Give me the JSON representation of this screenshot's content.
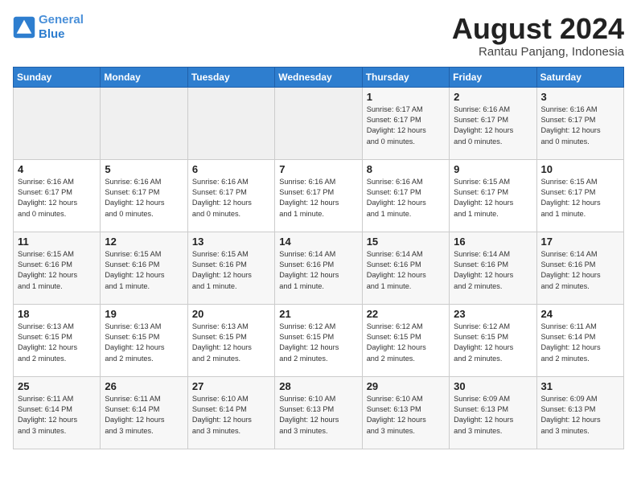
{
  "header": {
    "logo_line1": "General",
    "logo_line2": "Blue",
    "month_year": "August 2024",
    "location": "Rantau Panjang, Indonesia"
  },
  "days_of_week": [
    "Sunday",
    "Monday",
    "Tuesday",
    "Wednesday",
    "Thursday",
    "Friday",
    "Saturday"
  ],
  "weeks": [
    [
      {
        "day": "",
        "info": ""
      },
      {
        "day": "",
        "info": ""
      },
      {
        "day": "",
        "info": ""
      },
      {
        "day": "",
        "info": ""
      },
      {
        "day": "1",
        "info": "Sunrise: 6:17 AM\nSunset: 6:17 PM\nDaylight: 12 hours\nand 0 minutes."
      },
      {
        "day": "2",
        "info": "Sunrise: 6:16 AM\nSunset: 6:17 PM\nDaylight: 12 hours\nand 0 minutes."
      },
      {
        "day": "3",
        "info": "Sunrise: 6:16 AM\nSunset: 6:17 PM\nDaylight: 12 hours\nand 0 minutes."
      }
    ],
    [
      {
        "day": "4",
        "info": "Sunrise: 6:16 AM\nSunset: 6:17 PM\nDaylight: 12 hours\nand 0 minutes."
      },
      {
        "day": "5",
        "info": "Sunrise: 6:16 AM\nSunset: 6:17 PM\nDaylight: 12 hours\nand 0 minutes."
      },
      {
        "day": "6",
        "info": "Sunrise: 6:16 AM\nSunset: 6:17 PM\nDaylight: 12 hours\nand 0 minutes."
      },
      {
        "day": "7",
        "info": "Sunrise: 6:16 AM\nSunset: 6:17 PM\nDaylight: 12 hours\nand 1 minute."
      },
      {
        "day": "8",
        "info": "Sunrise: 6:16 AM\nSunset: 6:17 PM\nDaylight: 12 hours\nand 1 minute."
      },
      {
        "day": "9",
        "info": "Sunrise: 6:15 AM\nSunset: 6:17 PM\nDaylight: 12 hours\nand 1 minute."
      },
      {
        "day": "10",
        "info": "Sunrise: 6:15 AM\nSunset: 6:17 PM\nDaylight: 12 hours\nand 1 minute."
      }
    ],
    [
      {
        "day": "11",
        "info": "Sunrise: 6:15 AM\nSunset: 6:16 PM\nDaylight: 12 hours\nand 1 minute."
      },
      {
        "day": "12",
        "info": "Sunrise: 6:15 AM\nSunset: 6:16 PM\nDaylight: 12 hours\nand 1 minute."
      },
      {
        "day": "13",
        "info": "Sunrise: 6:15 AM\nSunset: 6:16 PM\nDaylight: 12 hours\nand 1 minute."
      },
      {
        "day": "14",
        "info": "Sunrise: 6:14 AM\nSunset: 6:16 PM\nDaylight: 12 hours\nand 1 minute."
      },
      {
        "day": "15",
        "info": "Sunrise: 6:14 AM\nSunset: 6:16 PM\nDaylight: 12 hours\nand 1 minute."
      },
      {
        "day": "16",
        "info": "Sunrise: 6:14 AM\nSunset: 6:16 PM\nDaylight: 12 hours\nand 2 minutes."
      },
      {
        "day": "17",
        "info": "Sunrise: 6:14 AM\nSunset: 6:16 PM\nDaylight: 12 hours\nand 2 minutes."
      }
    ],
    [
      {
        "day": "18",
        "info": "Sunrise: 6:13 AM\nSunset: 6:15 PM\nDaylight: 12 hours\nand 2 minutes."
      },
      {
        "day": "19",
        "info": "Sunrise: 6:13 AM\nSunset: 6:15 PM\nDaylight: 12 hours\nand 2 minutes."
      },
      {
        "day": "20",
        "info": "Sunrise: 6:13 AM\nSunset: 6:15 PM\nDaylight: 12 hours\nand 2 minutes."
      },
      {
        "day": "21",
        "info": "Sunrise: 6:12 AM\nSunset: 6:15 PM\nDaylight: 12 hours\nand 2 minutes."
      },
      {
        "day": "22",
        "info": "Sunrise: 6:12 AM\nSunset: 6:15 PM\nDaylight: 12 hours\nand 2 minutes."
      },
      {
        "day": "23",
        "info": "Sunrise: 6:12 AM\nSunset: 6:15 PM\nDaylight: 12 hours\nand 2 minutes."
      },
      {
        "day": "24",
        "info": "Sunrise: 6:11 AM\nSunset: 6:14 PM\nDaylight: 12 hours\nand 2 minutes."
      }
    ],
    [
      {
        "day": "25",
        "info": "Sunrise: 6:11 AM\nSunset: 6:14 PM\nDaylight: 12 hours\nand 3 minutes."
      },
      {
        "day": "26",
        "info": "Sunrise: 6:11 AM\nSunset: 6:14 PM\nDaylight: 12 hours\nand 3 minutes."
      },
      {
        "day": "27",
        "info": "Sunrise: 6:10 AM\nSunset: 6:14 PM\nDaylight: 12 hours\nand 3 minutes."
      },
      {
        "day": "28",
        "info": "Sunrise: 6:10 AM\nSunset: 6:13 PM\nDaylight: 12 hours\nand 3 minutes."
      },
      {
        "day": "29",
        "info": "Sunrise: 6:10 AM\nSunset: 6:13 PM\nDaylight: 12 hours\nand 3 minutes."
      },
      {
        "day": "30",
        "info": "Sunrise: 6:09 AM\nSunset: 6:13 PM\nDaylight: 12 hours\nand 3 minutes."
      },
      {
        "day": "31",
        "info": "Sunrise: 6:09 AM\nSunset: 6:13 PM\nDaylight: 12 hours\nand 3 minutes."
      }
    ]
  ]
}
